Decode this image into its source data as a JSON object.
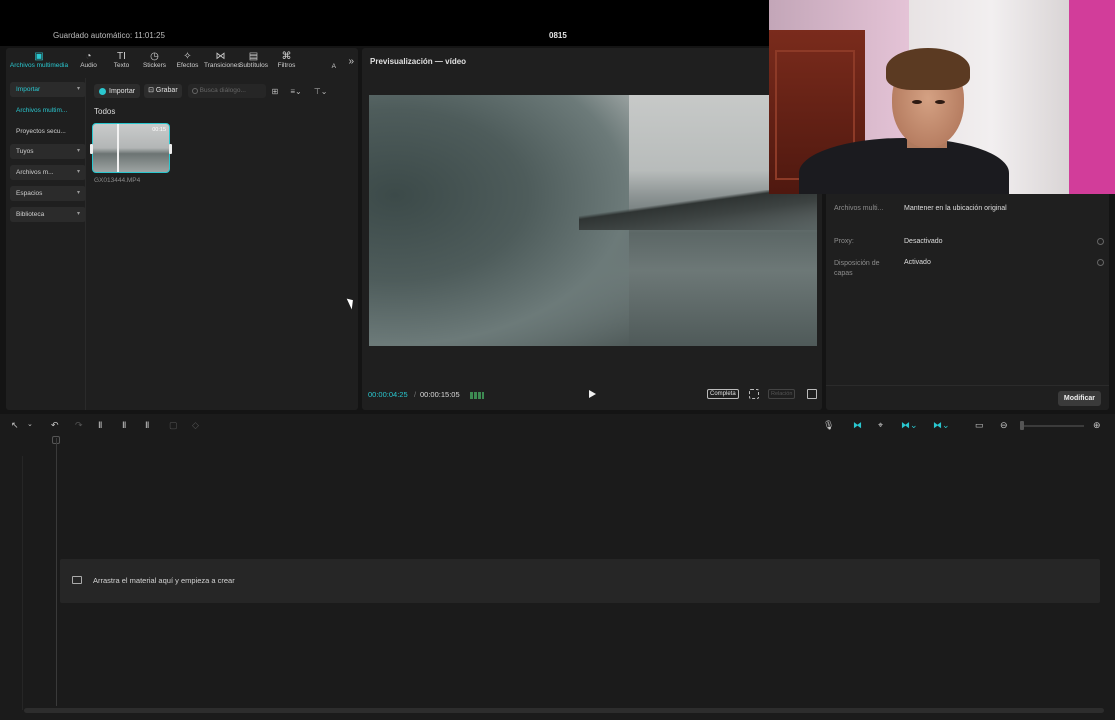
{
  "window": {
    "autosave_text": "Guardado automático: 11:01:25",
    "project_name": "0815"
  },
  "media_panel": {
    "tabs": [
      {
        "label": "Archivos multimedia",
        "icon": "media-icon",
        "glyph": "▣",
        "active": true
      },
      {
        "label": "Audio",
        "icon": "audio-icon",
        "glyph": "◔"
      },
      {
        "label": "Texto",
        "icon": "text-icon",
        "glyph": "TI"
      },
      {
        "label": "Stickers",
        "icon": "sticker-icon",
        "glyph": "◷"
      },
      {
        "label": "Efectos",
        "icon": "effects-icon",
        "glyph": "✧"
      },
      {
        "label": "Transiciones",
        "icon": "transitions-icon",
        "glyph": "⋈"
      },
      {
        "label": "Subtítulos",
        "icon": "subtitles-icon",
        "glyph": "▤"
      },
      {
        "label": "Filtros",
        "icon": "filters-icon",
        "glyph": "⌘"
      }
    ],
    "tab_overflow": "A",
    "more_glyph": "»",
    "sidebar": [
      {
        "label": "Importar",
        "chev": "▾",
        "boxed": true,
        "selected": true
      },
      {
        "label": "Archivos multim...",
        "selected": true
      },
      {
        "label": "Proyectos secu..."
      },
      {
        "label": "Tuyos",
        "chev": "▾",
        "boxed": true
      },
      {
        "label": "Archivos m...",
        "chev": "▾",
        "boxed": true
      },
      {
        "label": "Espacios",
        "chev": "▾",
        "boxed": true
      },
      {
        "label": "Biblioteca",
        "chev": "▾",
        "boxed": true
      }
    ],
    "import_button": "Importar",
    "record_button": "⊡ Grabar",
    "search_placeholder": "Busca diálogo...",
    "grid_icon": "⊞",
    "sort_icon": "≡⌄",
    "filter_icon": "⊤⌄",
    "section_label": "Todos",
    "clip": {
      "name": "GX013444.MP4",
      "duration": "00:15"
    }
  },
  "preview": {
    "title": "Previsualización — vídeo",
    "time_current": "00:00:04:25",
    "time_separator": "/",
    "time_total": "00:00:15:05",
    "completa_button": "Completa",
    "ratio_button": "Relación"
  },
  "properties": {
    "rows": [
      {
        "label": "Archivos multi...",
        "value": "Mantener en la ubicación original"
      },
      {
        "label": "Proxy:",
        "value": "Desactivado",
        "info": true
      },
      {
        "label": "Disposición de capas",
        "value": "Activado",
        "info": true
      }
    ],
    "modify_button": "Modificar"
  },
  "timeline": {
    "drop_text": "Arrastra el material aquí y empieza a crear",
    "tools": {
      "select": "↖",
      "select_menu": "⌄",
      "undo": "↶",
      "redo": "↷",
      "split": "Ⅱ",
      "split_left": "Ⅱ",
      "split_right": "Ⅱ",
      "delete": "▢",
      "shield": "◇",
      "mic": "🎙",
      "link_a": "⧓",
      "link_b": "⌖",
      "link_c": "⧓⌄",
      "link_d": "⧓⌄",
      "preview": "▭",
      "zoom_out": "⊖",
      "zoom_in": "⊕"
    }
  },
  "colors": {
    "accent": "#2ac7cf"
  }
}
